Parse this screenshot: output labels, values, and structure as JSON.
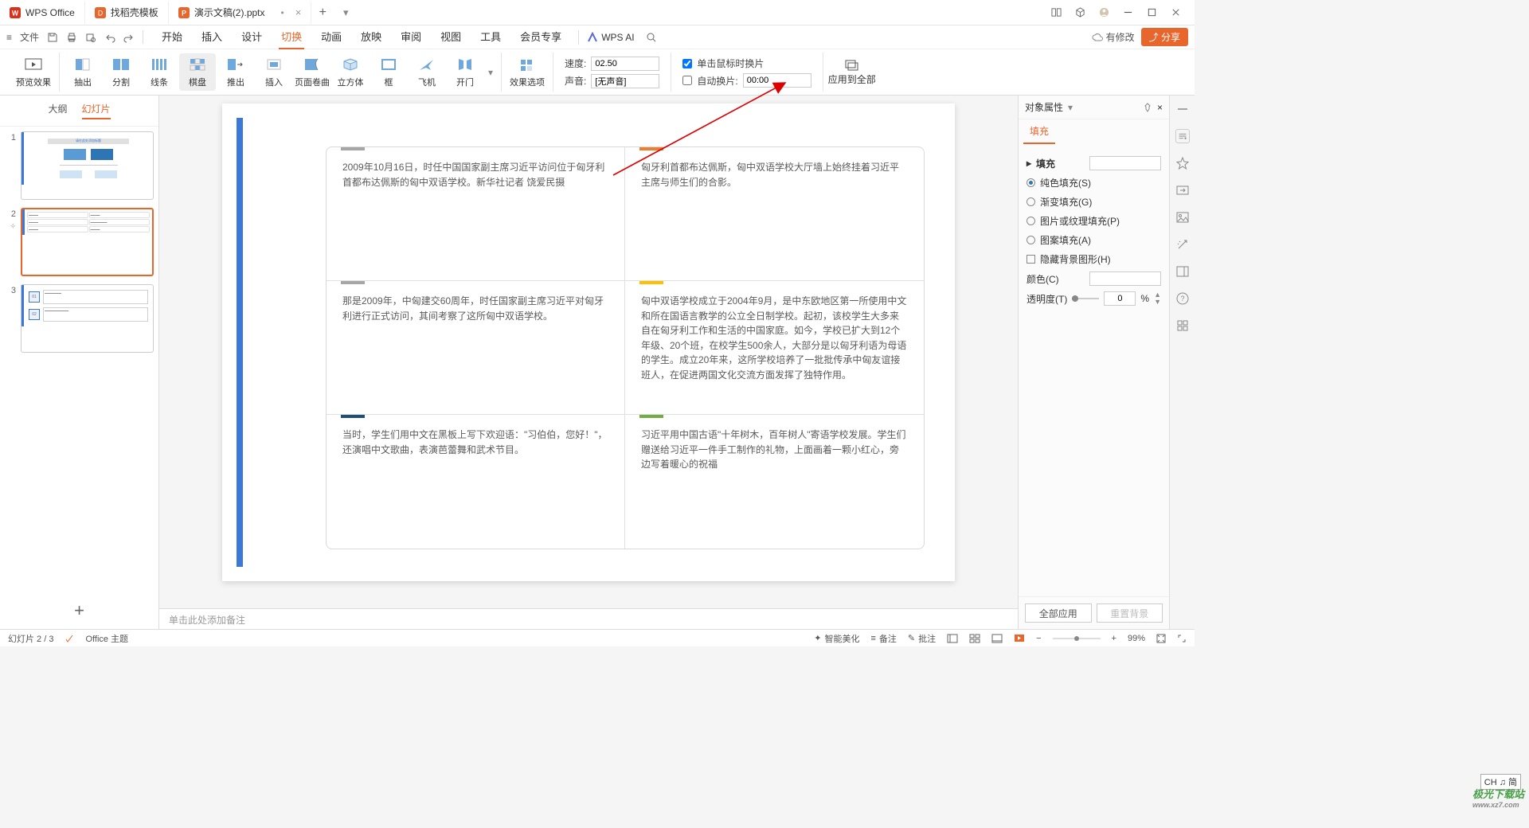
{
  "tabs": {
    "t1_label": "WPS Office",
    "t2_label": "找稻壳模板",
    "t3_label": "演示文稿(2).pptx"
  },
  "menubar": {
    "file": "文件",
    "items": [
      "开始",
      "插入",
      "设计",
      "切换",
      "动画",
      "放映",
      "审阅",
      "视图",
      "工具",
      "会员专享"
    ],
    "active_index": 3,
    "ai": "WPS AI",
    "pending": "有修改",
    "share": "分享"
  },
  "ribbon": {
    "preview": "预览效果",
    "trans": {
      "t0": "抽出",
      "t1": "分割",
      "t2": "线条",
      "t3": "棋盘",
      "t4": "推出",
      "t5": "插入",
      "t6": "页面卷曲",
      "t7": "立方体",
      "t8": "框",
      "t9": "飞机",
      "t10": "开门"
    },
    "effect_options": "效果选项",
    "speed": "速度:",
    "speed_val": "02.50",
    "sound": "声音:",
    "sound_val": "[无声音]",
    "on_click": "单击鼠标时换片",
    "auto": "自动换片:",
    "auto_val": "00:00",
    "apply_all": "应用到全部"
  },
  "thumbs": {
    "outline": "大纲",
    "slides": "幻灯片"
  },
  "slide": {
    "c1": "2009年10月16日，时任中国国家副主席习近平访问位于匈牙利首都布达佩斯的匈中双语学校。新华社记者 饶爱民摄",
    "c2": "匈牙利首都布达佩斯，匈中双语学校大厅墙上始终挂着习近平主席与师生们的合影。",
    "c3": "那是2009年，中匈建交60周年，时任国家副主席习近平对匈牙利进行正式访问，其间考察了这所匈中双语学校。",
    "c4": "匈中双语学校成立于2004年9月，是中东欧地区第一所使用中文和所在国语言教学的公立全日制学校。起初，该校学生大多来自在匈牙利工作和生活的中国家庭。如今，学校已扩大到12个年级、20个班，在校学生500余人，大部分是以匈牙利语为母语的学生。成立20年来，这所学校培养了一批批传承中匈友谊接班人，在促进两国文化交流方面发挥了独特作用。",
    "c5": "当时，学生们用中文在黑板上写下欢迎语：\"习伯伯，您好！\"，还演唱中文歌曲，表演芭蕾舞和武术节目。",
    "c6": "习近平用中国古语\"十年树木，百年树人\"寄语学校发展。学生们赠送给习近平一件手工制作的礼物，上面画着一颗小红心，旁边写着暖心的祝福"
  },
  "notes_placeholder": "单击此处添加备注",
  "rpanel": {
    "title": "对象属性",
    "tab": "填充",
    "section": "填充",
    "opt_solid": "纯色填充(S)",
    "opt_grad": "渐变填充(G)",
    "opt_pic": "图片或纹理填充(P)",
    "opt_pat": "图案填充(A)",
    "chk_hide": "隐藏背景图形(H)",
    "color": "颜色(C)",
    "opacity": "透明度(T)",
    "opacity_val": "0",
    "pct": "%",
    "btn_all": "全部应用",
    "btn_reset": "重置背景"
  },
  "statusbar": {
    "slide_pos": "幻灯片 2 / 3",
    "theme": "Office 主题",
    "smart": "智能美化",
    "notes_btn": "备注",
    "comments_btn": "批注",
    "zoom": "99%"
  },
  "ime": "CH ♫ 简",
  "watermark_t": "极光下载站",
  "watermark_s": "www.xz7.com",
  "thumb1_title": "请在此处添加标题"
}
